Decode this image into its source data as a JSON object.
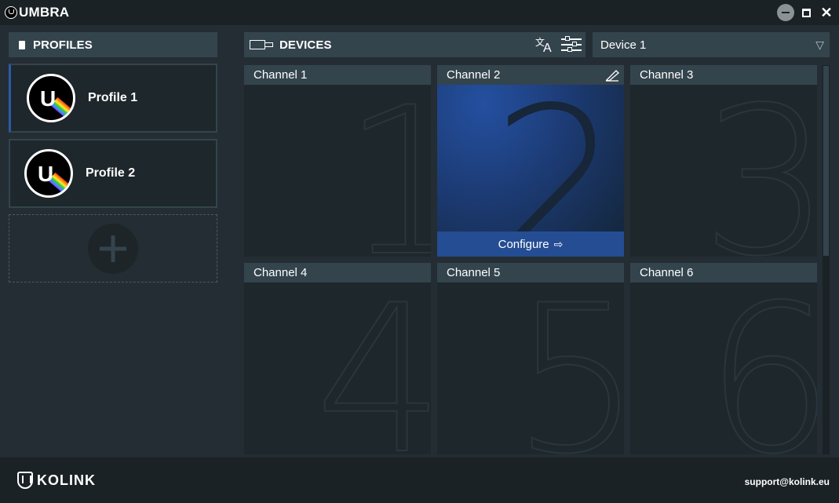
{
  "app": {
    "title": "UMBRA"
  },
  "window_controls": {
    "close_glyph": "✕"
  },
  "profiles": {
    "header": "PROFILES",
    "items": [
      {
        "name": "Profile 1",
        "active": true
      },
      {
        "name": "Profile 2",
        "active": false
      }
    ]
  },
  "devices": {
    "header": "DEVICES",
    "translate_glyph_small": "文",
    "translate_glyph_large": "A",
    "selected_device": "Device 1",
    "dropdown_arrow": "▽"
  },
  "channels": [
    {
      "title": "Channel 1",
      "number": "1"
    },
    {
      "title": "Channel 2",
      "number": "2",
      "selected": true,
      "configure_label": "Configure",
      "configure_arrow": "⇨"
    },
    {
      "title": "Channel 3",
      "number": "3"
    },
    {
      "title": "Channel 4",
      "number": "4"
    },
    {
      "title": "Channel 5",
      "number": "5"
    },
    {
      "title": "Channel 6",
      "number": "6"
    }
  ],
  "footer": {
    "brand": "KOLINK",
    "support_email": "support@kolink.eu"
  },
  "colors": {
    "accent": "#244d93",
    "panel": "#34444d",
    "background": "#232d33"
  }
}
